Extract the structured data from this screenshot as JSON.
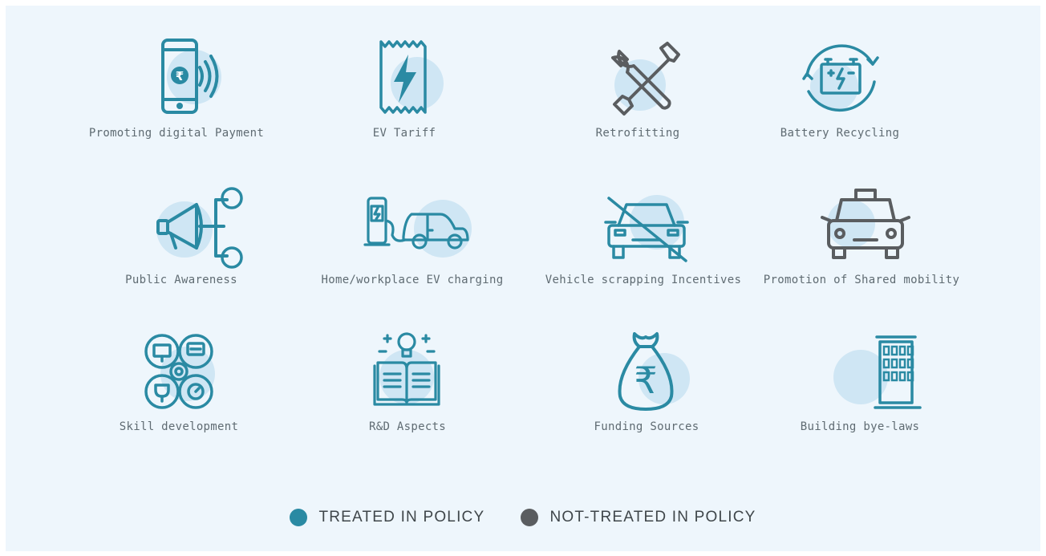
{
  "colors": {
    "treated": "#2a8aa3",
    "not_treated": "#5a5d60",
    "halo": "#cfe6f4",
    "background": "#eef6fc"
  },
  "items": [
    {
      "label": "Promoting digital Payment",
      "icon": "mobile-payment-icon",
      "status": "treated"
    },
    {
      "label": "EV Tariff",
      "icon": "ev-tariff-icon",
      "status": "treated"
    },
    {
      "label": "Retrofitting",
      "icon": "tools-icon",
      "status": "not_treated"
    },
    {
      "label": "Battery Recycling",
      "icon": "battery-recycle-icon",
      "status": "treated"
    },
    {
      "label": "Public Awareness",
      "icon": "megaphone-icon",
      "status": "treated"
    },
    {
      "label": "Home/workplace EV charging",
      "icon": "ev-charging-icon",
      "status": "treated"
    },
    {
      "label": "Vehicle scrapping Incentives",
      "icon": "car-scrapping-icon",
      "status": "not_treated"
    },
    {
      "label": "Promotion of Shared mobility",
      "icon": "taxi-icon",
      "status": "not_treated"
    },
    {
      "label": "Skill development",
      "icon": "skills-icon",
      "status": "treated"
    },
    {
      "label": "R&D Aspects",
      "icon": "research-book-icon",
      "status": "treated"
    },
    {
      "label": "Funding Sources",
      "icon": "money-bag-icon",
      "status": "treated"
    },
    {
      "label": "Building bye-laws",
      "icon": "building-icon",
      "status": "treated"
    }
  ],
  "legend": [
    {
      "label": "TREATED IN POLICY",
      "status": "treated"
    },
    {
      "label": "NOT-TREATED IN POLICY",
      "status": "not_treated"
    }
  ]
}
